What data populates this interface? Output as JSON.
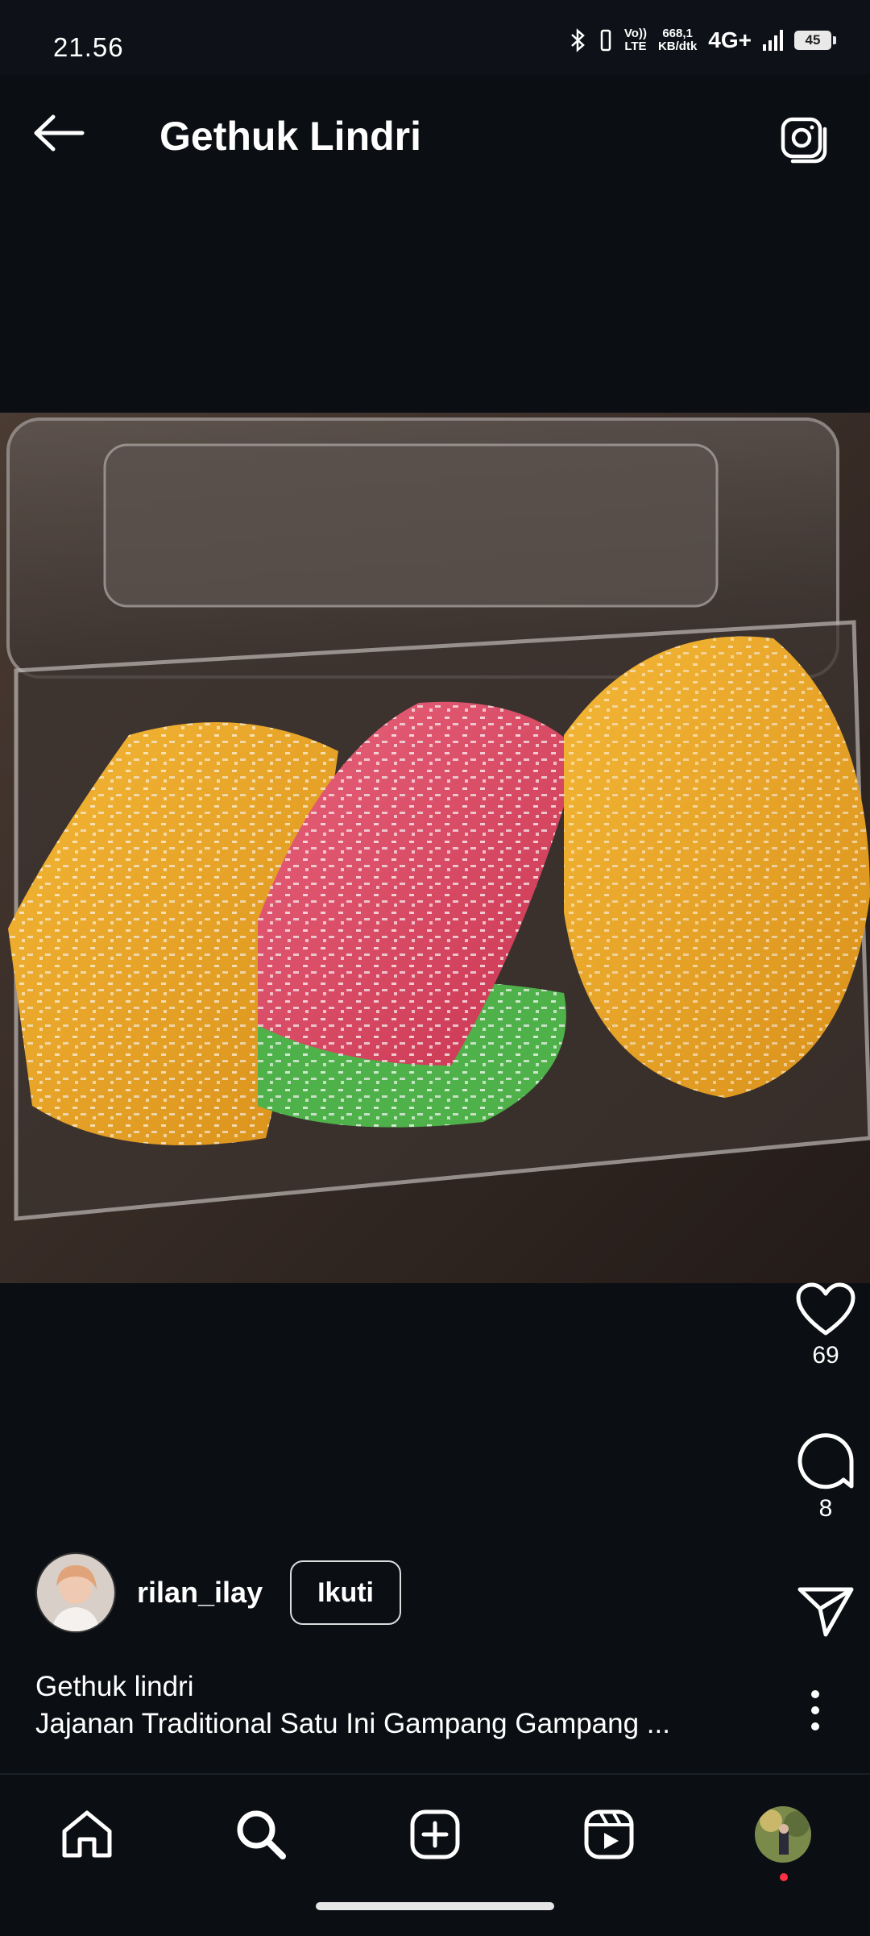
{
  "status_bar": {
    "time": "21.56",
    "volte_top": "Vo))",
    "volte_bottom": "LTE",
    "speed_value": "668,1",
    "speed_unit": "KB/dtk",
    "network": "4G+",
    "battery": "45"
  },
  "header": {
    "title": "Gethuk Lindri",
    "back_icon": "arrow-left-icon",
    "camera_icon": "camera-icon"
  },
  "post": {
    "image": "gethuk-lindri-photo",
    "likes": "69",
    "comments": "8",
    "author": {
      "username": "rilan_ilay",
      "follow_label": "Ikuti"
    },
    "caption": {
      "line1": "Gethuk lindri",
      "line2": "Jajanan Traditional Satu Ini Gampang Gampang ..."
    }
  },
  "bottom_nav": {
    "items": [
      "home-icon",
      "search-icon",
      "create-icon",
      "reels-icon",
      "profile-avatar"
    ]
  },
  "colors": {
    "background": "#0b0e13",
    "text": "#ffffff",
    "notification": "#ff3040"
  }
}
